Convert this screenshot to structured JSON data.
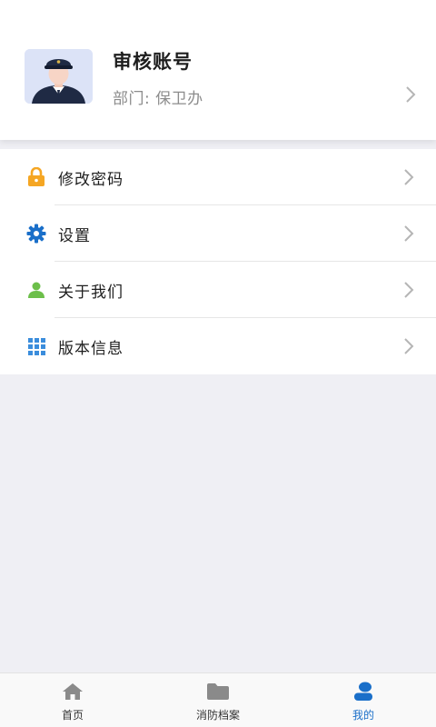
{
  "profile": {
    "name": "审核账号",
    "department": "部门: 保卫办"
  },
  "menu": {
    "items": [
      {
        "label": "修改密码",
        "icon": "lock-icon",
        "color": "#f5a623"
      },
      {
        "label": "设置",
        "icon": "gear-icon",
        "color": "#1a6fc9"
      },
      {
        "label": "关于我们",
        "icon": "person-icon",
        "color": "#6cbf4a"
      },
      {
        "label": "版本信息",
        "icon": "grid-icon",
        "color": "#3b8ddc"
      }
    ]
  },
  "tabbar": {
    "tabs": [
      {
        "label": "首页",
        "icon": "home-icon"
      },
      {
        "label": "消防档案",
        "icon": "folder-icon"
      },
      {
        "label": "我的",
        "icon": "user-icon",
        "active": true
      }
    ]
  },
  "colors": {
    "accent": "#1a6fc9",
    "background": "#efeff4"
  }
}
